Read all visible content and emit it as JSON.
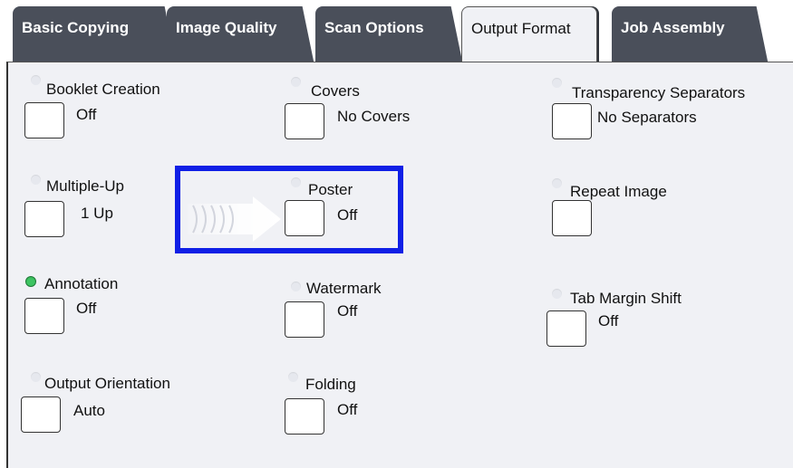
{
  "tabs": [
    {
      "label": "Basic Copying",
      "active": false
    },
    {
      "label": "Image Quality",
      "active": false
    },
    {
      "label": "Scan Options",
      "active": false
    },
    {
      "label": "Output Format",
      "active": true
    },
    {
      "label": "Job Assembly",
      "active": false
    }
  ],
  "features": {
    "booklet_creation": {
      "label": "Booklet Creation",
      "value": "Off"
    },
    "covers": {
      "label": "Covers",
      "value": "No Covers"
    },
    "transparency_separators": {
      "label": "Transparency Separators",
      "value": "No Separators"
    },
    "multiple_up": {
      "label": "Multiple-Up",
      "value": "1 Up"
    },
    "poster": {
      "label": "Poster",
      "value": "Off"
    },
    "repeat_image": {
      "label": "Repeat Image",
      "value": ""
    },
    "annotation": {
      "label": "Annotation",
      "value": "Off",
      "indicator": "on"
    },
    "watermark": {
      "label": "Watermark",
      "value": "Off"
    },
    "tab_margin_shift": {
      "label": "Tab Margin Shift",
      "value": "Off"
    },
    "output_orientation": {
      "label": "Output Orientation",
      "value": "Auto"
    },
    "folding": {
      "label": "Folding",
      "value": "Off"
    }
  },
  "colors": {
    "highlight": "#0f1fe6",
    "indicator_on": "#3ec462",
    "tab_inactive": "#4a4f5a",
    "panel": "#f0f1f5"
  },
  "icons": {
    "pointer": "arrow-pointer-icon"
  }
}
